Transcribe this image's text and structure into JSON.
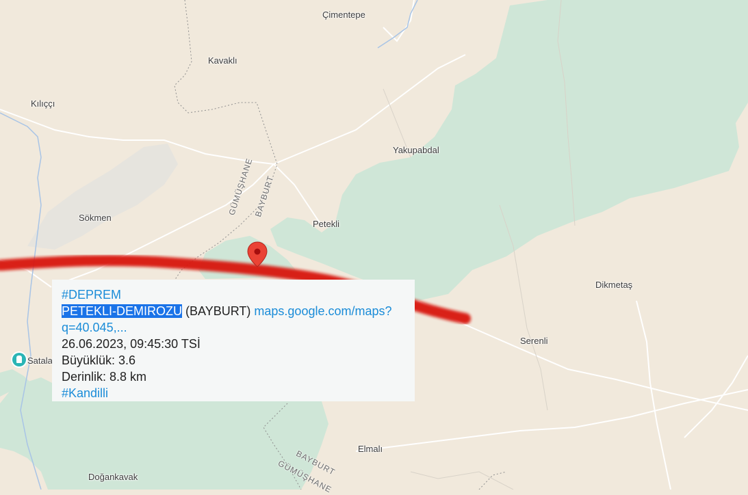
{
  "map": {
    "places": [
      {
        "id": "cimentepe",
        "name": "Çimentepe"
      },
      {
        "id": "kavakli",
        "name": "Kavaklı"
      },
      {
        "id": "kilicci",
        "name": "Kılıççı"
      },
      {
        "id": "yakupabdal",
        "name": "Yakupabdal"
      },
      {
        "id": "sokmen",
        "name": "Sökmen"
      },
      {
        "id": "petekli",
        "name": "Petekli"
      },
      {
        "id": "dikmetas",
        "name": "Dikmetaş"
      },
      {
        "id": "serenli",
        "name": "Serenli"
      },
      {
        "id": "elmali",
        "name": "Elmalı"
      },
      {
        "id": "dogankavak",
        "name": "Doğankavak"
      },
      {
        "id": "satala",
        "name": "Satala"
      }
    ],
    "border_labels": {
      "gumushane_top": "GÜMÜŞHANE",
      "bayburt_top": "BAYBURT",
      "bayburt_bottom": "BAYBURT",
      "gumushane_bottom": "GÜMÜŞHANE"
    },
    "colors": {
      "land": "#f1e9dc",
      "forest": "#cfe6d7",
      "marker": "#ea4335",
      "scribble": "#d8120c"
    },
    "marker_icon": "map-pin-icon",
    "poi_icon": "landmark-icon"
  },
  "tweet": {
    "hashtag": "#DEPREM",
    "location_highlight": "PETEKLI-DEMIROZU",
    "province": "(BAYBURT)",
    "link_text": "maps.google.com/maps?q=40.045,...",
    "datetime": "26.06.2023, 09:45:30 TSİ",
    "magnitude": "Büyüklük: 3.6",
    "depth": "Derinlik: 8.8 km",
    "source_tag": "#Kandilli"
  }
}
